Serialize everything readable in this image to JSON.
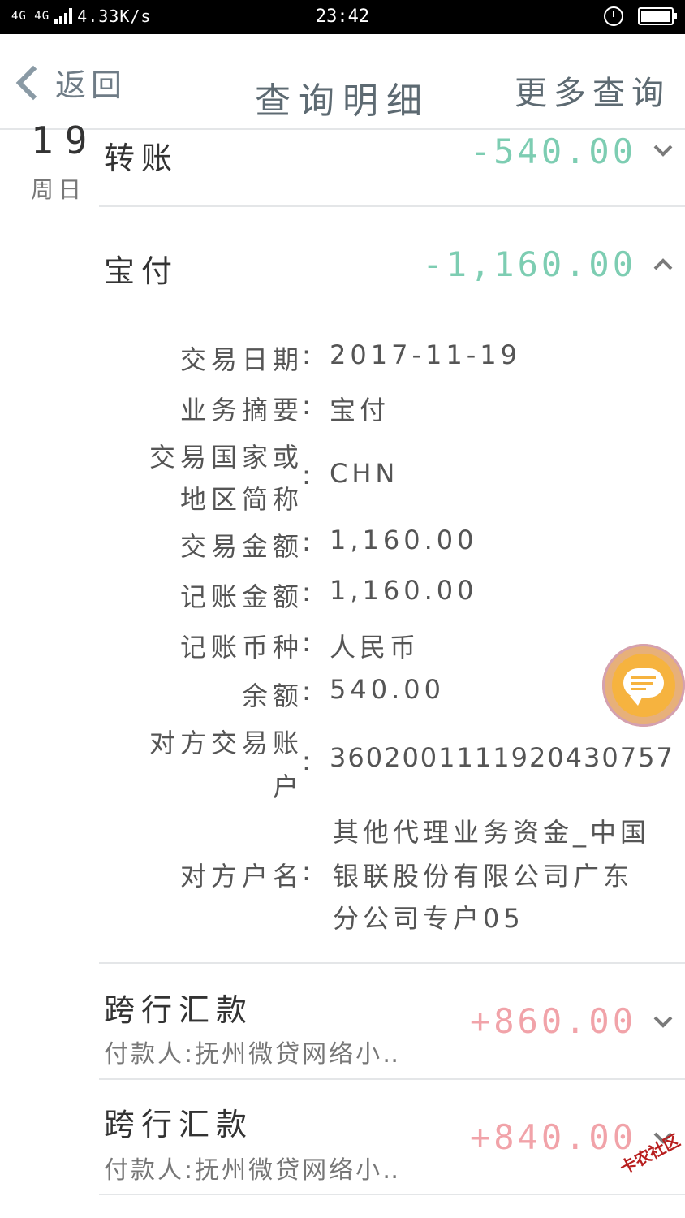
{
  "status_bar": {
    "network": "4G 4G",
    "speed": "4.33K/s",
    "time": "23:42"
  },
  "header": {
    "back_label": "返回",
    "title": "查询明细",
    "more_label": "更多查询"
  },
  "date_group": {
    "day": "19",
    "weekday": "周日"
  },
  "transactions": [
    {
      "title": "转账",
      "amount": "-540.00",
      "expanded": false
    },
    {
      "title": "宝付",
      "amount": "-1,160.00",
      "expanded": true
    },
    {
      "title": "跨行汇款",
      "subtitle": "付款人:抚州微贷网络小‥",
      "amount": "+860.00",
      "expanded": false
    },
    {
      "title": "跨行汇款",
      "subtitle": "付款人:抚州微贷网络小‥",
      "amount": "+840.00",
      "expanded": false
    }
  ],
  "details": {
    "trade_date_label": "交易日期",
    "trade_date": "2017-11-19",
    "summary_label": "业务摘要",
    "summary": "宝付",
    "country_label_1": "交易国家或",
    "country_label_2": "地区简称",
    "country": "CHN",
    "trade_amount_label": "交易金额",
    "trade_amount": "1,160.00",
    "book_amount_label": "记账金额",
    "book_amount": "1,160.00",
    "currency_label": "记账币种",
    "currency": "人民币",
    "balance_label": "余额",
    "balance": "540.00",
    "counter_account_label_1": "对方交易账",
    "counter_account_label_2": "户",
    "counter_account": "3602001111920430757",
    "counter_name_label": "对方户名",
    "counter_name_1": "其他代理业务资金_中国",
    "counter_name_2": "银联股份有限公司广东",
    "counter_name_3": "分公司专户05"
  },
  "watermark": "卡农社区",
  "colors": {
    "negative": "#7dcdb2",
    "positive": "#f1a3a9",
    "header_text": "#5d6a72",
    "divider": "#e4e6e8"
  },
  "icons": {
    "back": "chevron-left-icon",
    "expand": "chevron-down-icon",
    "collapse": "chevron-up-icon",
    "chat": "chat-bubble-icon"
  }
}
